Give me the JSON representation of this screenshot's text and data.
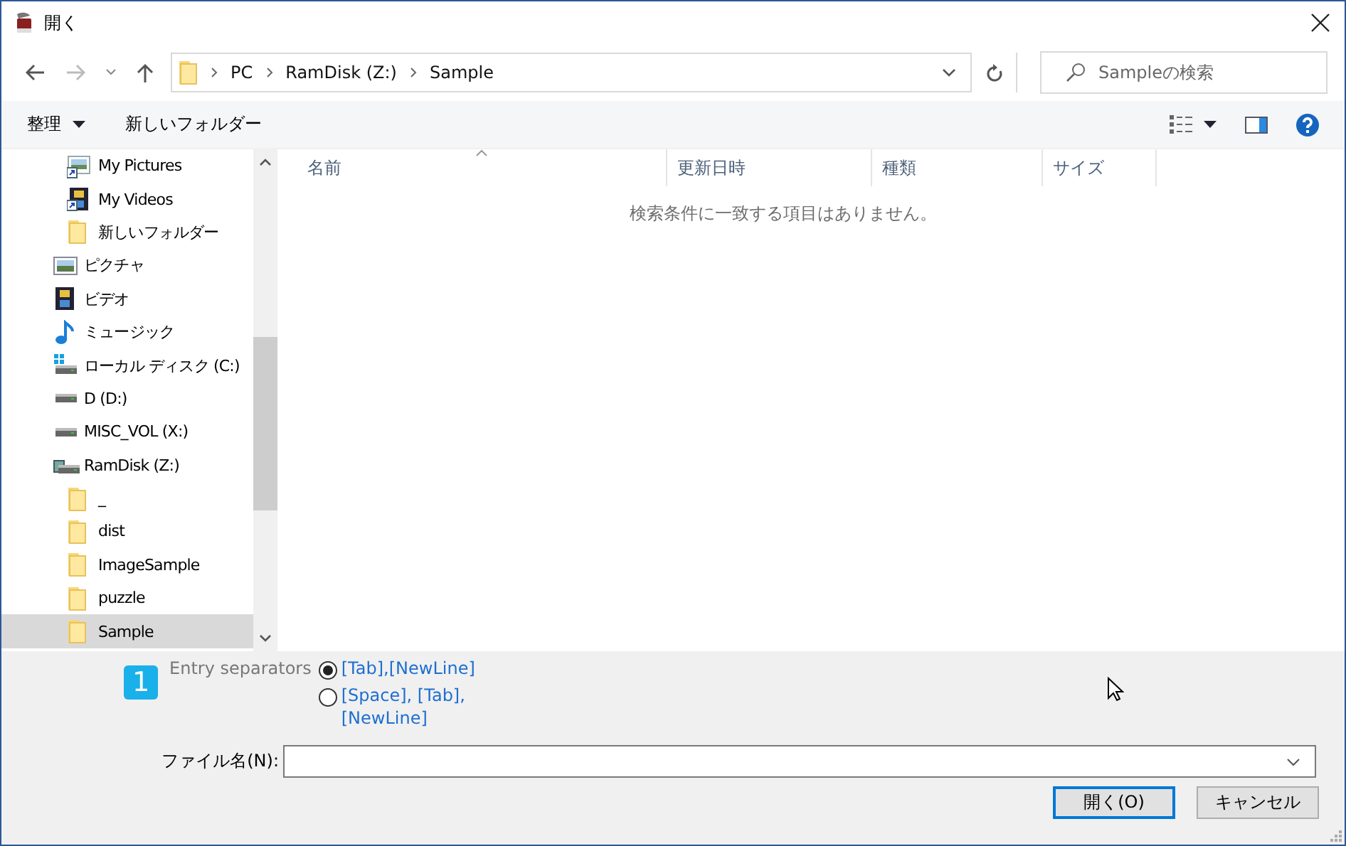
{
  "window": {
    "title": "開く"
  },
  "nav": {
    "path": [
      "PC",
      "RamDisk (Z:)",
      "Sample"
    ],
    "search": {
      "placeholder": "Sampleの検索"
    }
  },
  "toolbar": {
    "organize": "整理",
    "new_folder": "新しいフォルダー"
  },
  "tree": [
    {
      "children": [
        {
          "label": "My Pictures",
          "kind": "picture-shortcut",
          "selected": false
        },
        {
          "label": "My Videos",
          "kind": "video-shortcut",
          "selected": false
        },
        {
          "label": "新しいフォルダー",
          "kind": "folder",
          "selected": false
        }
      ]
    },
    {
      "label": "ピクチャ",
      "kind": "pictures",
      "selected": false
    },
    {
      "label": "ビデオ",
      "kind": "videos",
      "selected": false
    },
    {
      "label": "ミュージック",
      "kind": "music",
      "selected": false
    },
    {
      "label": "ローカル ディスク (C:)",
      "kind": "system-drive",
      "selected": false
    },
    {
      "label": "D (D:)",
      "kind": "drive",
      "selected": false
    },
    {
      "label": "MISC_VOL (X:)",
      "kind": "drive",
      "selected": false
    },
    {
      "label": "RamDisk (Z:)",
      "kind": "ramdisk",
      "selected": false,
      "children": [
        {
          "label": "_",
          "kind": "folder",
          "selected": false
        },
        {
          "label": "dist",
          "kind": "folder",
          "selected": false
        },
        {
          "label": "ImageSample",
          "kind": "folder",
          "selected": false
        },
        {
          "label": "puzzle",
          "kind": "folder",
          "selected": false
        },
        {
          "label": "Sample",
          "kind": "folder",
          "selected": true
        }
      ]
    }
  ],
  "table": {
    "columns": [
      "名前",
      "更新日時",
      "種類",
      "サイズ"
    ],
    "empty_message": "検索条件に一致する項目はありません。"
  },
  "options": {
    "badge": "1",
    "label": "Entry separators",
    "choices": [
      {
        "label": "[Tab],[NewLine]",
        "selected": true
      },
      {
        "label": "[Space], [Tab],[NewLine]",
        "selected": false
      }
    ]
  },
  "file_name": {
    "label": "ファイル名(N):"
  },
  "buttons": [
    {
      "label": "開く(O)",
      "kind": "default"
    },
    {
      "label": "キャンセル",
      "kind": "normal"
    }
  ]
}
